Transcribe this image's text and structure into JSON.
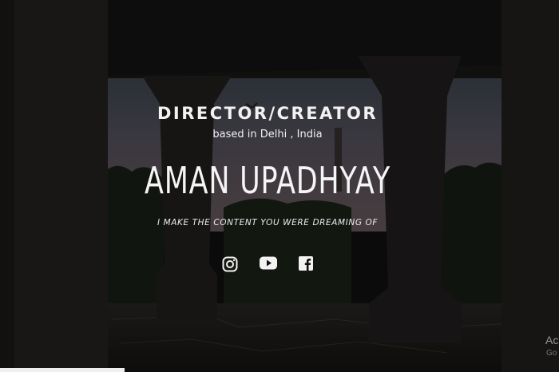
{
  "hero": {
    "role": "DIRECTOR/CREATOR",
    "location": "based in Delhi , India",
    "name": "AMAN UPADHYAY",
    "tagline": "I MAKE THE CONTENT YOU WERE DREAMING OF"
  },
  "socials": [
    {
      "icon": "instagram-icon"
    },
    {
      "icon": "youtube-icon"
    },
    {
      "icon": "facebook-icon"
    }
  ],
  "watermark": {
    "title": "Ac",
    "subtitle": "Go"
  },
  "colors": {
    "text": "#f2f2f2",
    "overlay": "#000000"
  }
}
